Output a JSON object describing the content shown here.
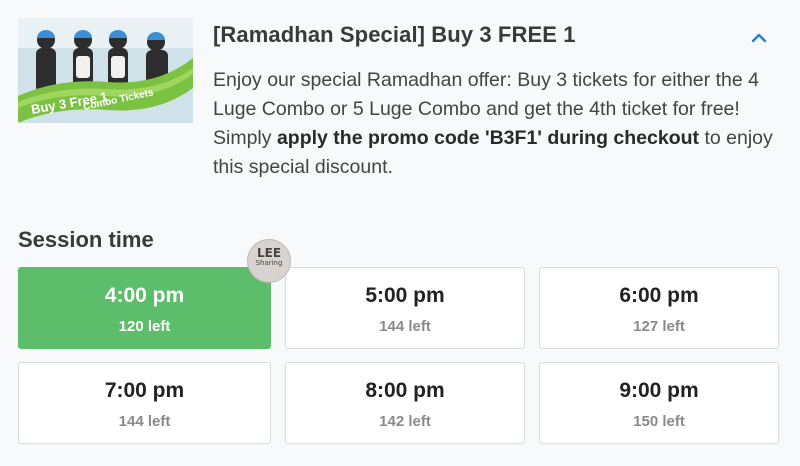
{
  "promo": {
    "thumbnail_text": [
      "Buy 3 Free 1",
      "Combo Tickets"
    ],
    "title": "[Ramadhan Special] Buy 3 FREE 1",
    "desc_part1": "Enjoy our special Ramadhan offer: Buy 3 tickets for either the 4 Luge Combo or 5 Luge Combo and get the 4th ticket for free! Simply ",
    "desc_bold1": "apply the promo code 'B3F1'",
    "desc_bold2": "during checkout",
    "desc_part2": " to enjoy this special discount.",
    "toggle_icon": "chevron-up-icon"
  },
  "session": {
    "heading": "Session time",
    "slots": [
      {
        "time": "4:00 pm",
        "left": "120 left",
        "selected": true
      },
      {
        "time": "5:00 pm",
        "left": "144 left",
        "selected": false
      },
      {
        "time": "6:00 pm",
        "left": "127 left",
        "selected": false
      },
      {
        "time": "7:00 pm",
        "left": "144 left",
        "selected": false
      },
      {
        "time": "8:00 pm",
        "left": "142 left",
        "selected": false
      },
      {
        "time": "9:00 pm",
        "left": "150 left",
        "selected": false
      }
    ]
  },
  "watermark": {
    "line1": "LEE",
    "line2": "Sharing"
  },
  "colors": {
    "selected_slot": "#5cbd6a",
    "accent_chevron": "#2a7fd4",
    "background": "#f7f9fa"
  }
}
